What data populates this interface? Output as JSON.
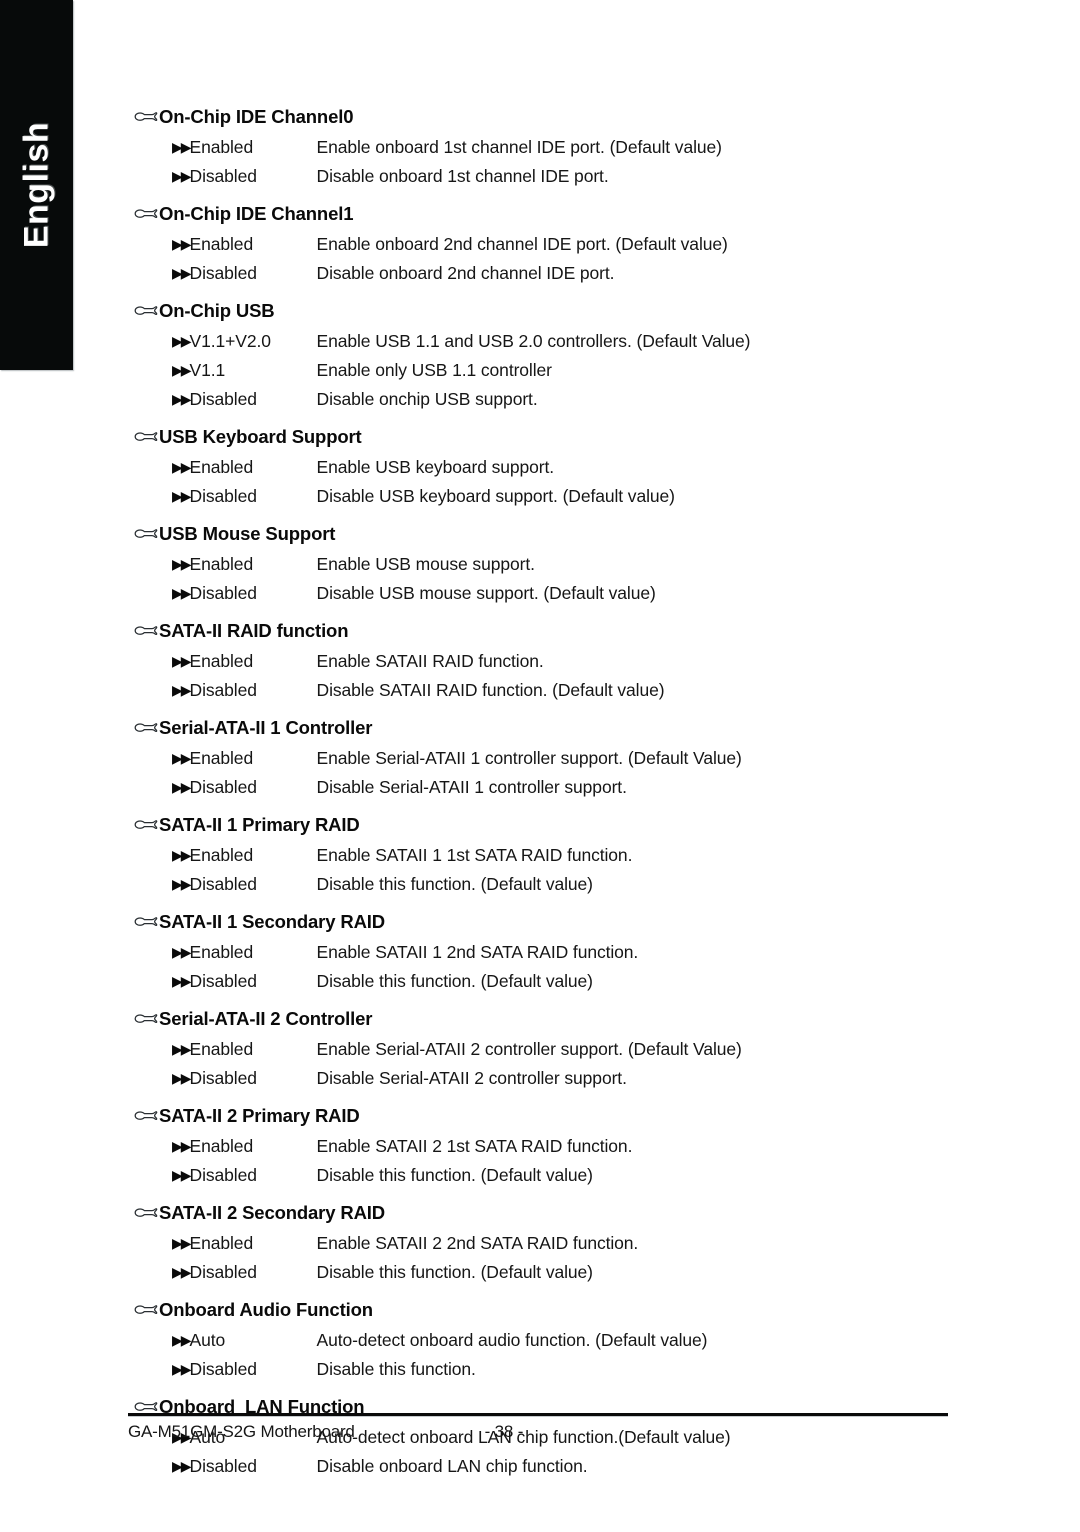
{
  "language_tab": {
    "label": "English"
  },
  "icons": {
    "section_bullet": "pointing-hand-icon",
    "option_bullet": "double-triangle-icon",
    "option_marker_glyph": "▶▶"
  },
  "sections": [
    {
      "title": "On-Chip IDE Channel0",
      "options": [
        {
          "label": "Enabled",
          "desc": "Enable onboard 1st channel IDE port. (Default value)"
        },
        {
          "label": "Disabled",
          "desc": "Disable onboard 1st channel IDE port."
        }
      ]
    },
    {
      "title": "On-Chip IDE Channel1",
      "options": [
        {
          "label": "Enabled",
          "desc": "Enable onboard 2nd channel IDE port. (Default value)"
        },
        {
          "label": "Disabled",
          "desc": "Disable onboard 2nd channel IDE port."
        }
      ]
    },
    {
      "title": "On-Chip USB",
      "options": [
        {
          "label": "V1.1+V2.0",
          "desc": "Enable USB 1.1 and USB 2.0 controllers. (Default Value)"
        },
        {
          "label": "V1.1",
          "desc": "Enable only USB 1.1 controller"
        },
        {
          "label": "Disabled",
          "desc": "Disable onchip USB support."
        }
      ]
    },
    {
      "title": "USB Keyboard Support",
      "options": [
        {
          "label": "Enabled",
          "desc": "Enable USB keyboard support."
        },
        {
          "label": "Disabled",
          "desc": "Disable USB keyboard support. (Default value)"
        }
      ]
    },
    {
      "title": "USB Mouse Support",
      "options": [
        {
          "label": "Enabled",
          "desc": "Enable USB mouse support."
        },
        {
          "label": "Disabled",
          "desc": "Disable USB mouse support. (Default value)"
        }
      ]
    },
    {
      "title": "SATA-II RAID function",
      "options": [
        {
          "label": "Enabled",
          "desc": "Enable SATAII RAID function."
        },
        {
          "label": "Disabled",
          "desc": "Disable SATAII RAID function. (Default value)"
        }
      ]
    },
    {
      "title": "Serial-ATA-II 1 Controller",
      "options": [
        {
          "label": "Enabled",
          "desc": "Enable Serial-ATAII 1 controller support. (Default Value)"
        },
        {
          "label": "Disabled",
          "desc": "Disable Serial-ATAII 1 controller support."
        }
      ]
    },
    {
      "title": "SATA-II 1 Primary RAID",
      "options": [
        {
          "label": "Enabled",
          "desc": "Enable SATAII 1 1st SATA RAID function."
        },
        {
          "label": "Disabled",
          "desc": "Disable this function. (Default value)"
        }
      ]
    },
    {
      "title": "SATA-II 1 Secondary RAID",
      "options": [
        {
          "label": "Enabled",
          "desc": "Enable SATAII 1 2nd SATA RAID function."
        },
        {
          "label": "Disabled",
          "desc": "Disable this function. (Default value)"
        }
      ]
    },
    {
      "title": "Serial-ATA-II 2 Controller",
      "options": [
        {
          "label": "Enabled",
          "desc": "Enable Serial-ATAII 2 controller support. (Default Value)"
        },
        {
          "label": "Disabled",
          "desc": "Disable Serial-ATAII 2 controller support."
        }
      ]
    },
    {
      "title": "SATA-II 2 Primary RAID",
      "options": [
        {
          "label": "Enabled",
          "desc": "Enable SATAII 2 1st SATA RAID function."
        },
        {
          "label": "Disabled",
          "desc": "Disable this function. (Default value)"
        }
      ]
    },
    {
      "title": "SATA-II 2 Secondary RAID",
      "options": [
        {
          "label": "Enabled",
          "desc": "Enable SATAII 2 2nd SATA RAID function."
        },
        {
          "label": "Disabled",
          "desc": "Disable this function. (Default value)"
        }
      ]
    },
    {
      "title": "Onboard Audio Function",
      "options": [
        {
          "label": "Auto",
          "desc": "Auto-detect onboard audio function. (Default value)"
        },
        {
          "label": "Disabled",
          "desc": "Disable this function."
        }
      ]
    },
    {
      "title": "Onboard  LAN Function",
      "options": [
        {
          "label": "Auto",
          "desc": "Auto-detect onboard LAN chip function.(Default value)"
        },
        {
          "label": "Disabled",
          "desc": "Disable onboard LAN chip function."
        }
      ]
    }
  ],
  "footer": {
    "document": "GA-M51GM-S2G Motherboard",
    "page": "- 38 -"
  },
  "colors": {
    "tab_background": "#070a0a",
    "tab_text": "#ffffff",
    "body_text": "#0a0a0a",
    "page_background": "#ffffff"
  }
}
